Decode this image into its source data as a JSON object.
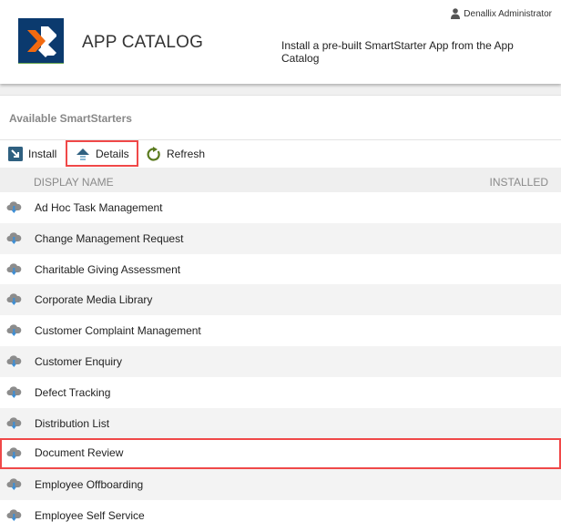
{
  "header": {
    "app_title": "APP CATALOG",
    "user_name": "Denallix Administrator",
    "tagline": "Install a pre-built SmartStarter App from the App Catalog",
    "logo_colors": {
      "background": "#0b3a6e",
      "accent": "#f26a10",
      "stroke": "#ffffff"
    }
  },
  "section": {
    "title": "Available SmartStarters"
  },
  "toolbar": {
    "install_label": "Install",
    "details_label": "Details",
    "refresh_label": "Refresh",
    "highlighted": "details"
  },
  "table": {
    "columns": [
      "DISPLAY NAME",
      "INSTALLED"
    ],
    "rows": [
      {
        "name": "Ad Hoc Task Management",
        "installed": ""
      },
      {
        "name": "Change Management Request",
        "installed": ""
      },
      {
        "name": "Charitable Giving Assessment",
        "installed": ""
      },
      {
        "name": "Corporate Media Library",
        "installed": ""
      },
      {
        "name": "Customer Complaint Management",
        "installed": ""
      },
      {
        "name": "Customer Enquiry",
        "installed": ""
      },
      {
        "name": "Defect Tracking",
        "installed": ""
      },
      {
        "name": "Distribution List",
        "installed": ""
      },
      {
        "name": "Document Review",
        "installed": "",
        "highlighted": true
      },
      {
        "name": "Employee Offboarding",
        "installed": ""
      },
      {
        "name": "Employee Self Service",
        "installed": ""
      }
    ],
    "row_icon": "cloud-download-icon"
  },
  "colors": {
    "highlight": "#f04848",
    "row_alt": "#f3f3f3",
    "header_bg": "#efefef"
  }
}
